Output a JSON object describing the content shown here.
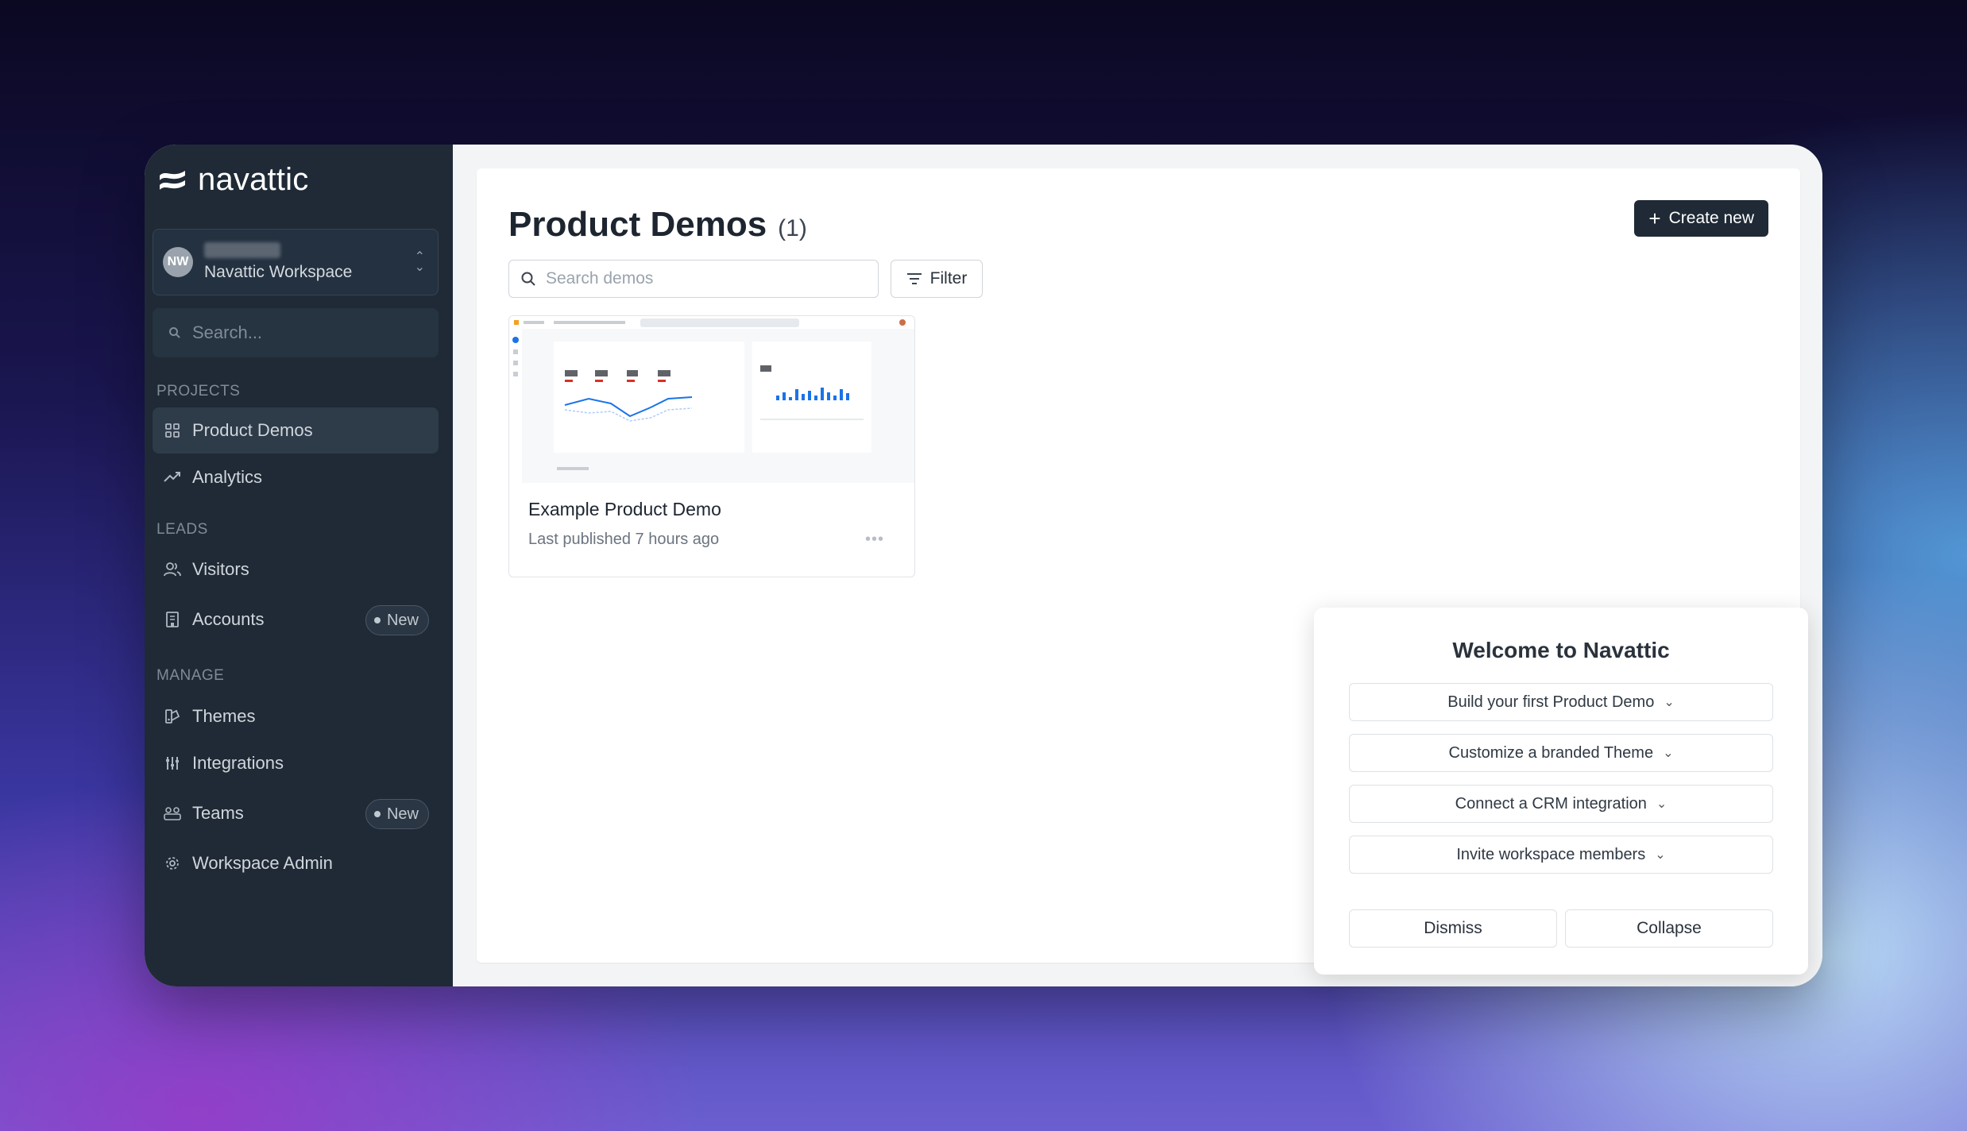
{
  "brand": {
    "name": "navattic"
  },
  "workspace": {
    "avatar_initials": "NW",
    "name": "Navattic Workspace"
  },
  "sidebar": {
    "search_placeholder": "Search...",
    "sections": {
      "projects": "PROJECTS",
      "leads": "LEADS",
      "manage": "MANAGE"
    },
    "items": [
      {
        "label": "Product Demos",
        "icon": "grid-icon",
        "active": true
      },
      {
        "label": "Analytics",
        "icon": "trend-icon"
      },
      {
        "label": "Visitors",
        "icon": "users-icon"
      },
      {
        "label": "Accounts",
        "icon": "building-icon",
        "badge": "New"
      },
      {
        "label": "Themes",
        "icon": "palette-icon"
      },
      {
        "label": "Integrations",
        "icon": "sliders-icon"
      },
      {
        "label": "Teams",
        "icon": "team-icon",
        "badge": "New"
      },
      {
        "label": "Workspace Admin",
        "icon": "gear-icon"
      }
    ]
  },
  "main": {
    "title": "Product Demos",
    "count": "(1)",
    "create_label": "Create new",
    "search_placeholder": "Search demos",
    "filter_label": "Filter",
    "demos": [
      {
        "name": "Example Product Demo",
        "meta": "Last published 7 hours ago"
      }
    ]
  },
  "welcome": {
    "title": "Welcome to Navattic",
    "steps": [
      "Build your first Product Demo",
      "Customize a branded Theme",
      "Connect a CRM integration",
      "Invite workspace members"
    ],
    "dismiss_label": "Dismiss",
    "collapse_label": "Collapse"
  },
  "colors": {
    "sidebar_bg": "#1f2a36",
    "primary_button": "#1f2a36",
    "chart_blue": "#1a73e8"
  }
}
